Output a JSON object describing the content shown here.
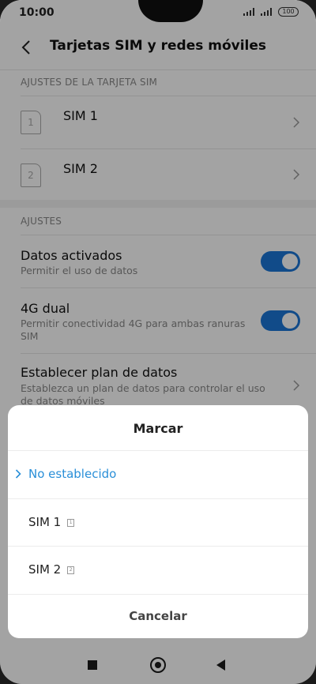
{
  "status_bar": {
    "time": "10:00",
    "battery": "100"
  },
  "header": {
    "title": "Tarjetas SIM y redes móviles",
    "back_icon": "back-arrow-icon"
  },
  "sim_section": {
    "title": "AJUSTES DE LA TARJETA SIM",
    "items": [
      {
        "number": "1",
        "label": "SIM 1"
      },
      {
        "number": "2",
        "label": "SIM 2"
      }
    ]
  },
  "settings_section": {
    "title": "AJUSTES",
    "data": {
      "title": "Datos activados",
      "subtitle": "Permitir el uso de datos",
      "enabled": true
    },
    "dual4g": {
      "title": "4G dual",
      "subtitle": "Permitir conectividad 4G para ambas ranuras SIM",
      "enabled": true
    },
    "data_plan": {
      "title": "Establecer plan de datos",
      "subtitle": "Establezca un plan de datos para controlar el uso de datos móviles"
    }
  },
  "dialog": {
    "title": "Marcar",
    "options": [
      {
        "label": "No establecido",
        "selected": true,
        "sim": ""
      },
      {
        "label": "SIM 1",
        "selected": false,
        "sim": "1"
      },
      {
        "label": "SIM 2",
        "selected": false,
        "sim": "2"
      }
    ],
    "cancel": "Cancelar"
  },
  "colors": {
    "accent": "#1b76d6",
    "selected_text": "#2a8fd8",
    "overlay": "rgba(0,0,0,0.36)"
  }
}
